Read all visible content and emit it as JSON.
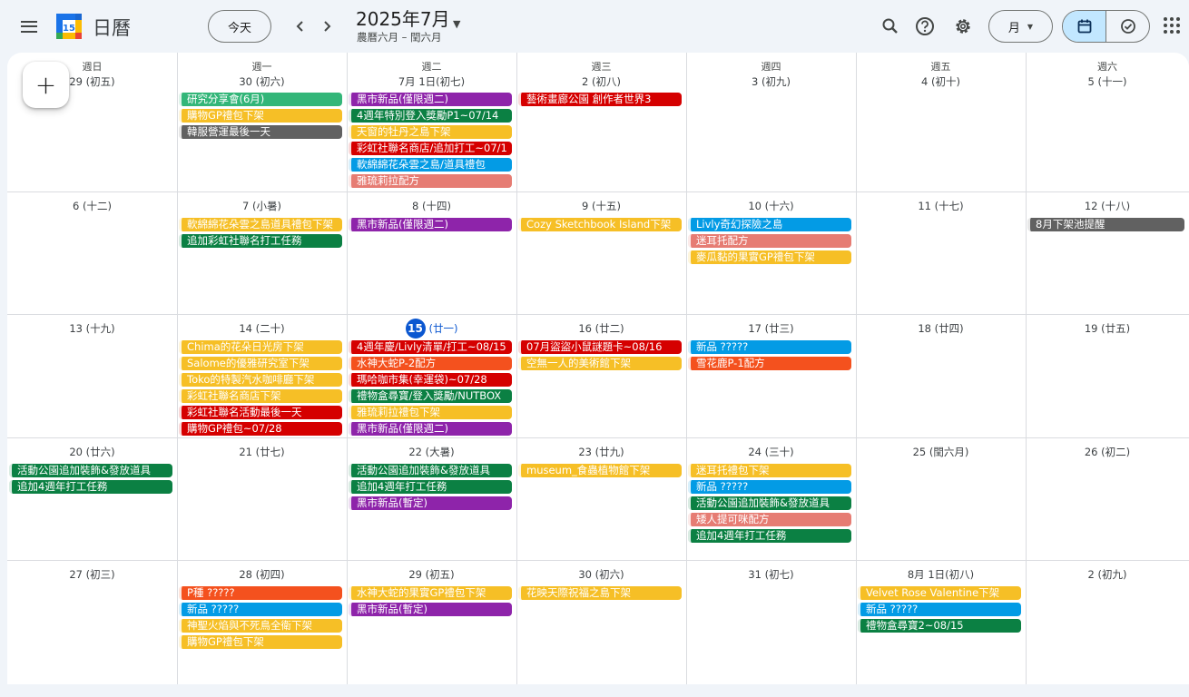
{
  "header": {
    "app_title": "日曆",
    "logo_day": "15",
    "today_button": "今天",
    "date_title": "2025年7月",
    "date_subtitle": "農曆六月 – 閏六月",
    "view_label": "月"
  },
  "colors": {
    "purple": "#8e24aa",
    "green": "#0b8043",
    "yellow": "#f6bf26",
    "red": "#d50000",
    "blue": "#039be5",
    "salmon": "#e67c73",
    "orange": "#f4511e",
    "mint": "#33b679",
    "gray": "#616161",
    "accent": "#0b57d0"
  },
  "weekdays": [
    "週日",
    "週一",
    "週二",
    "週三",
    "週四",
    "週五",
    "週六"
  ],
  "weeks": [
    {
      "days": [
        {
          "label": "29 (初五)",
          "events": []
        },
        {
          "label": "30 (初六)",
          "events": [
            {
              "title": "研究分享會(6月)",
              "color": "mint"
            },
            {
              "title": "購物GP禮包下架",
              "color": "yellow"
            },
            {
              "title": "韓服營運最後一天",
              "color": "gray"
            }
          ]
        },
        {
          "label": "7月 1日(初七)",
          "events": [
            {
              "title": "黑市新品(僅限週二)",
              "color": "purple"
            },
            {
              "title": "4週年特別登入獎勵P1~07/14",
              "color": "green"
            },
            {
              "title": "天窗的牡丹之島下架",
              "color": "yellow"
            },
            {
              "title": "彩虹社聯名商店/追加打工~07/1",
              "color": "red"
            },
            {
              "title": "軟綿綿花朵雲之島/道具禮包",
              "color": "blue"
            },
            {
              "title": "雅琉莉拉配方",
              "color": "salmon"
            }
          ]
        },
        {
          "label": "2 (初八)",
          "events": [
            {
              "title": "藝術畫廊公園 創作者世界3",
              "color": "red"
            }
          ]
        },
        {
          "label": "3 (初九)",
          "events": []
        },
        {
          "label": "4 (初十)",
          "events": []
        },
        {
          "label": "5 (十一)",
          "events": []
        }
      ]
    },
    {
      "days": [
        {
          "label": "6 (十二)",
          "events": []
        },
        {
          "label": "7 (小暑)",
          "events": [
            {
              "title": "軟綿綿花朵雲之島道具禮包下架",
              "color": "yellow"
            },
            {
              "title": "追加彩虹社聯名打工任務",
              "color": "green"
            }
          ]
        },
        {
          "label": "8 (十四)",
          "events": [
            {
              "title": "黑市新品(僅限週二)",
              "color": "purple"
            }
          ]
        },
        {
          "label": "9 (十五)",
          "events": [
            {
              "title": "Cozy Sketchbook Island下架",
              "color": "yellow"
            }
          ]
        },
        {
          "label": "10 (十六)",
          "events": [
            {
              "title": "Livly奇幻探險之島",
              "color": "blue"
            },
            {
              "title": "迷耳托配方",
              "color": "salmon"
            },
            {
              "title": "麥瓜黏的果實GP禮包下架",
              "color": "yellow"
            }
          ]
        },
        {
          "label": "11 (十七)",
          "events": []
        },
        {
          "label": "12 (十八)",
          "events": [
            {
              "title": "8月下架池提醒",
              "color": "gray"
            }
          ]
        }
      ]
    },
    {
      "days": [
        {
          "label": "13 (十九)",
          "events": []
        },
        {
          "label": "14 (二十)",
          "events": [
            {
              "title": "Chima的花朵日光房下架",
              "color": "yellow"
            },
            {
              "title": "Salome的優雅研究室下架",
              "color": "yellow"
            },
            {
              "title": "Toko的特製汽水咖啡廳下架",
              "color": "yellow"
            },
            {
              "title": "彩虹社聯名商店下架",
              "color": "yellow"
            },
            {
              "title": "彩虹社聯名活動最後一天",
              "color": "red"
            },
            {
              "title": "購物GP禮包~07/28",
              "color": "red"
            }
          ]
        },
        {
          "label": "(廿一)",
          "badge": "15",
          "today": true,
          "events": [
            {
              "title": "4週年慶/Livly清單/打工~08/15",
              "color": "red"
            },
            {
              "title": "水神大蛇P-2配方",
              "color": "orange"
            },
            {
              "title": "瑪哈咖市集(幸運袋)~07/28",
              "color": "red"
            },
            {
              "title": "禮物盒尋寶/登入獎勵/NUTBOX",
              "color": "green"
            },
            {
              "title": "雅琉莉拉禮包下架",
              "color": "yellow"
            },
            {
              "title": "黑市新品(僅限週二)",
              "color": "purple"
            }
          ]
        },
        {
          "label": "16 (廿二)",
          "events": [
            {
              "title": "07月盜盜小鼠謎題卡~08/16",
              "color": "red"
            },
            {
              "title": "空無一人的美術館下架",
              "color": "yellow"
            }
          ]
        },
        {
          "label": "17 (廿三)",
          "events": [
            {
              "title": "新品 ?????",
              "color": "blue"
            },
            {
              "title": "雪花鹿P-1配方",
              "color": "orange"
            }
          ]
        },
        {
          "label": "18 (廿四)",
          "events": []
        },
        {
          "label": "19 (廿五)",
          "events": []
        }
      ]
    },
    {
      "days": [
        {
          "label": "20 (廿六)",
          "events": [
            {
              "title": "活動公園追加裝飾&發放道具",
              "color": "green"
            },
            {
              "title": "追加4週年打工任務",
              "color": "green"
            }
          ]
        },
        {
          "label": "21 (廿七)",
          "events": []
        },
        {
          "label": "22 (大暑)",
          "events": [
            {
              "title": "活動公園追加裝飾&發放道具",
              "color": "green"
            },
            {
              "title": "追加4週年打工任務",
              "color": "green"
            },
            {
              "title": "黑市新品(暫定)",
              "color": "purple"
            }
          ]
        },
        {
          "label": "23 (廿九)",
          "events": [
            {
              "title": "museum_食蟲植物館下架",
              "color": "yellow"
            }
          ]
        },
        {
          "label": "24 (三十)",
          "events": [
            {
              "title": "迷耳托禮包下架",
              "color": "yellow"
            },
            {
              "title": "新品 ?????",
              "color": "blue"
            },
            {
              "title": "活動公園追加裝飾&發放道具",
              "color": "green"
            },
            {
              "title": "矮人提可咪配方",
              "color": "salmon"
            },
            {
              "title": "追加4週年打工任務",
              "color": "green"
            }
          ]
        },
        {
          "label": "25 (閏六月)",
          "events": []
        },
        {
          "label": "26 (初二)",
          "events": []
        }
      ]
    },
    {
      "days": [
        {
          "label": "27 (初三)",
          "events": []
        },
        {
          "label": "28 (初四)",
          "events": [
            {
              "title": "P種 ?????",
              "color": "orange"
            },
            {
              "title": "新品 ?????",
              "color": "blue"
            },
            {
              "title": "神聖火焰與不死鳥全衛下架",
              "color": "yellow"
            },
            {
              "title": "購物GP禮包下架",
              "color": "yellow"
            }
          ]
        },
        {
          "label": "29 (初五)",
          "events": [
            {
              "title": "水神大蛇的果實GP禮包下架",
              "color": "yellow"
            },
            {
              "title": "黑市新品(暫定)",
              "color": "purple"
            }
          ]
        },
        {
          "label": "30 (初六)",
          "events": [
            {
              "title": "花映天際祝福之島下架",
              "color": "yellow"
            }
          ]
        },
        {
          "label": "31 (初七)",
          "events": []
        },
        {
          "label": "8月 1日(初八)",
          "events": [
            {
              "title": "Velvet Rose Valentine下架",
              "color": "yellow"
            },
            {
              "title": "新品 ?????",
              "color": "blue"
            },
            {
              "title": "禮物盒尋寶2~08/15",
              "color": "green"
            }
          ]
        },
        {
          "label": "2 (初九)",
          "events": []
        }
      ]
    }
  ],
  "spanning_events": [
    {
      "week": 3,
      "start": 0,
      "span": 1,
      "title": "活動公園追加裝飾&發放道具"
    }
  ]
}
